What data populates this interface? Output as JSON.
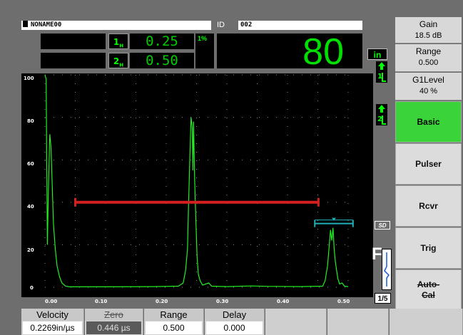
{
  "header": {
    "filename": "NONAME00",
    "id_label": "ID",
    "id_value": "002"
  },
  "readings": {
    "gate1_tag": "1",
    "gate1_sub": "T\nH",
    "gate1_value": "0.25",
    "gate2_tag": "2",
    "gate2_value": "0.50",
    "percent_tag": "1%",
    "main_value": "80",
    "unit": "in"
  },
  "params": {
    "gain_label": "Gain",
    "gain_value": "18.5 dB",
    "range_label": "Range",
    "range_value": "0.500",
    "g1level_label": "G1Level",
    "g1level_value": "40 %"
  },
  "menu": [
    {
      "label": "Basic",
      "active": true
    },
    {
      "label": "Pulser",
      "active": false
    },
    {
      "label": "Rcvr",
      "active": false
    },
    {
      "label": "Trig",
      "active": false
    },
    {
      "label": "Auto-\nCal",
      "active": false
    }
  ],
  "scan": {
    "y_labels": [
      "100",
      "80",
      "60",
      "40",
      "20",
      "0"
    ],
    "x_labels": [
      "0.00",
      "0.10",
      "0.20",
      "0.30",
      "0.40",
      "0.50"
    ],
    "gate1_level_pct": 40,
    "gate1_start": 0.05,
    "gate1_end": 0.451,
    "gate2_level_pct": 30,
    "gate2_start": 0.445,
    "gate2_end": 0.508,
    "gate_colors": {
      "gate1": "#d42020",
      "gate2": "#20b0b8"
    },
    "trace_color": "#22ee22"
  },
  "side": {
    "sd_label": "SD",
    "f_label": "F",
    "page_indicator": "1/5"
  },
  "bottom": [
    {
      "label": "Velocity",
      "value": "0.2269in/µs",
      "disabled": false
    },
    {
      "label": "Zero",
      "value": "0.446 µs",
      "disabled": true
    },
    {
      "label": "Range",
      "value": "0.500",
      "disabled": false
    },
    {
      "label": "Delay",
      "value": "0.000",
      "disabled": false
    }
  ]
}
